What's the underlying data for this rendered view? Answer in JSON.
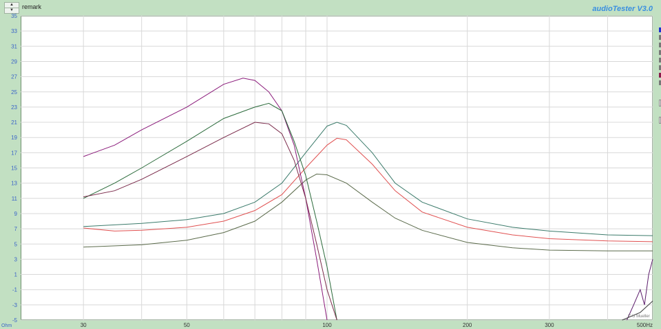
{
  "header": {
    "remark_label": "remark",
    "app_title": "audioTester  V3.0",
    "spin_up": "▲",
    "spin_down": "▼"
  },
  "copyright": "© U Mueller",
  "y_unit": "Ohm",
  "x_unit_label": "500Hz",
  "side_marks": [
    "#2030d0",
    "#777777",
    "#777777",
    "#777777",
    "#777777",
    "#777777",
    "#8a1a4a",
    "#777777"
  ],
  "chart_data": {
    "type": "line",
    "x_scale": "log",
    "xlim": [
      22,
      500
    ],
    "ylim": [
      -5,
      35
    ],
    "y_ticks": [
      35,
      33,
      31,
      29,
      27,
      25,
      23,
      21,
      19,
      17,
      15,
      13,
      11,
      9,
      7,
      5,
      3,
      1,
      -1,
      -3,
      -5
    ],
    "x_ticks": [
      {
        "value": 30,
        "label": "30"
      },
      {
        "value": 50,
        "label": "50"
      },
      {
        "value": 100,
        "label": "100"
      },
      {
        "value": 200,
        "label": "200"
      },
      {
        "value": 300,
        "label": "300"
      },
      {
        "value": 500,
        "label": "500Hz"
      }
    ],
    "x_grid": [
      30,
      40,
      50,
      60,
      70,
      80,
      90,
      100,
      200,
      300,
      400,
      500
    ],
    "grid": true,
    "series": [
      {
        "color": "#3a7a6a",
        "points": [
          [
            30,
            7.3
          ],
          [
            40,
            7.7
          ],
          [
            50,
            8.2
          ],
          [
            60,
            9.0
          ],
          [
            70,
            10.5
          ],
          [
            80,
            13.0
          ],
          [
            90,
            17.0
          ],
          [
            100,
            20.5
          ],
          [
            105,
            21.0
          ],
          [
            110,
            20.6
          ],
          [
            125,
            17.0
          ],
          [
            140,
            13.0
          ],
          [
            160,
            10.5
          ],
          [
            200,
            8.3
          ],
          [
            250,
            7.2
          ],
          [
            300,
            6.7
          ],
          [
            400,
            6.2
          ],
          [
            500,
            6.1
          ]
        ]
      },
      {
        "color": "#e05050",
        "points": [
          [
            30,
            7.1
          ],
          [
            35,
            6.7
          ],
          [
            40,
            6.8
          ],
          [
            50,
            7.2
          ],
          [
            60,
            8.0
          ],
          [
            70,
            9.4
          ],
          [
            80,
            11.5
          ],
          [
            90,
            15.0
          ],
          [
            100,
            18.0
          ],
          [
            105,
            18.9
          ],
          [
            110,
            18.7
          ],
          [
            125,
            15.5
          ],
          [
            140,
            12.0
          ],
          [
            160,
            9.2
          ],
          [
            200,
            7.2
          ],
          [
            250,
            6.2
          ],
          [
            300,
            5.7
          ],
          [
            400,
            5.4
          ],
          [
            500,
            5.3
          ]
        ]
      },
      {
        "color": "#5a6a4a",
        "points": [
          [
            30,
            4.6
          ],
          [
            40,
            4.9
          ],
          [
            50,
            5.5
          ],
          [
            60,
            6.5
          ],
          [
            70,
            8.0
          ],
          [
            80,
            10.5
          ],
          [
            90,
            13.4
          ],
          [
            95,
            14.2
          ],
          [
            100,
            14.1
          ],
          [
            110,
            13.0
          ],
          [
            125,
            10.5
          ],
          [
            140,
            8.4
          ],
          [
            160,
            6.8
          ],
          [
            200,
            5.2
          ],
          [
            250,
            4.5
          ],
          [
            300,
            4.2
          ],
          [
            400,
            4.1
          ],
          [
            500,
            4.1
          ]
        ]
      },
      {
        "color": "#8a1a7a",
        "points": [
          [
            30,
            16.5
          ],
          [
            35,
            18.0
          ],
          [
            40,
            20.0
          ],
          [
            50,
            23.0
          ],
          [
            60,
            26.0
          ],
          [
            66,
            26.8
          ],
          [
            70,
            26.5
          ],
          [
            75,
            25.0
          ],
          [
            80,
            22.5
          ],
          [
            85,
            18.0
          ],
          [
            90,
            11.0
          ],
          [
            95,
            3.0
          ],
          [
            100,
            -5.0
          ]
        ]
      },
      {
        "color": "#2a6a3a",
        "points": [
          [
            30,
            11.0
          ],
          [
            35,
            13.0
          ],
          [
            40,
            15.0
          ],
          [
            50,
            18.5
          ],
          [
            60,
            21.5
          ],
          [
            70,
            23.0
          ],
          [
            75,
            23.5
          ],
          [
            80,
            22.5
          ],
          [
            85,
            18.5
          ],
          [
            90,
            14.0
          ],
          [
            95,
            8.0
          ],
          [
            100,
            2.0
          ],
          [
            105,
            -5.0
          ]
        ]
      },
      {
        "color": "#7a2a4a",
        "points": [
          [
            30,
            11.2
          ],
          [
            35,
            12.0
          ],
          [
            40,
            13.5
          ],
          [
            50,
            16.5
          ],
          [
            60,
            19.0
          ],
          [
            70,
            21.0
          ],
          [
            75,
            20.8
          ],
          [
            80,
            19.5
          ],
          [
            85,
            16.0
          ],
          [
            90,
            11.0
          ],
          [
            95,
            5.0
          ],
          [
            100,
            -1.0
          ],
          [
            105,
            -5.0
          ]
        ]
      },
      {
        "color": "#5a1a6a",
        "points": [
          [
            440,
            -5.0
          ],
          [
            455,
            -3.0
          ],
          [
            470,
            -1.0
          ],
          [
            480,
            -3.0
          ],
          [
            490,
            1.0
          ],
          [
            500,
            3.0
          ]
        ]
      },
      {
        "color": "#3a3a3a",
        "points": [
          [
            430,
            -5.0
          ],
          [
            470,
            -4.0
          ],
          [
            500,
            -2.5
          ]
        ]
      }
    ]
  }
}
